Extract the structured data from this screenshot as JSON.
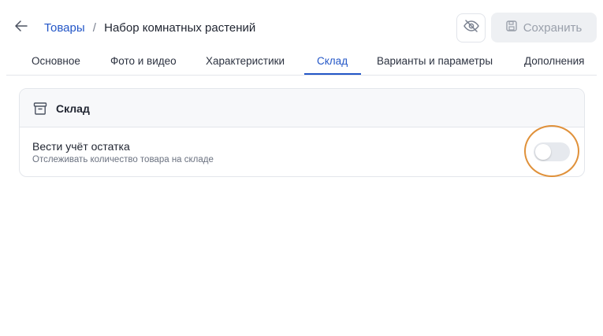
{
  "header": {
    "breadcrumb_parent": "Товары",
    "breadcrumb_separator": "/",
    "breadcrumb_current": "Набор комнатных растений",
    "save_label": "Сохранить",
    "back_icon": "arrow-left-icon",
    "hide_icon": "eye-off-icon",
    "save_icon": "floppy-disk-icon"
  },
  "tabs": [
    {
      "label": "Основное",
      "active": false
    },
    {
      "label": "Фото и видео",
      "active": false
    },
    {
      "label": "Характеристики",
      "active": false
    },
    {
      "label": "Склад",
      "active": true
    },
    {
      "label": "Варианты и параметры",
      "active": false
    },
    {
      "label": "Дополнения",
      "active": false
    }
  ],
  "card": {
    "title": "Склад",
    "icon": "archive-box-icon",
    "setting_title": "Вести учёт остатка",
    "setting_description": "Отслеживать количество товара на складе",
    "toggle_on": false
  },
  "colors": {
    "accent": "#2356c7",
    "highlight_ring": "#e0913a",
    "toggle_off": "#e6e9ee"
  }
}
